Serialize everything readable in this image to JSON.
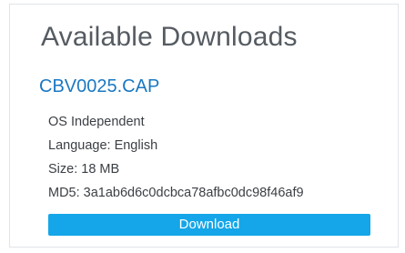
{
  "panel": {
    "title": "Available Downloads",
    "file_name": "CBV0025.CAP",
    "details": {
      "os": "OS Independent",
      "language": "Language: English",
      "size": "Size: 18 MB",
      "md5": "MD5: 3a1ab6d6c0dcbca78afbc0dc98f46af9"
    },
    "download_label": "Download"
  },
  "colors": {
    "link": "#1a78c2",
    "button": "#14a6e8",
    "title": "#555b61",
    "text": "#3b3f44",
    "border": "#e1e4e8"
  }
}
